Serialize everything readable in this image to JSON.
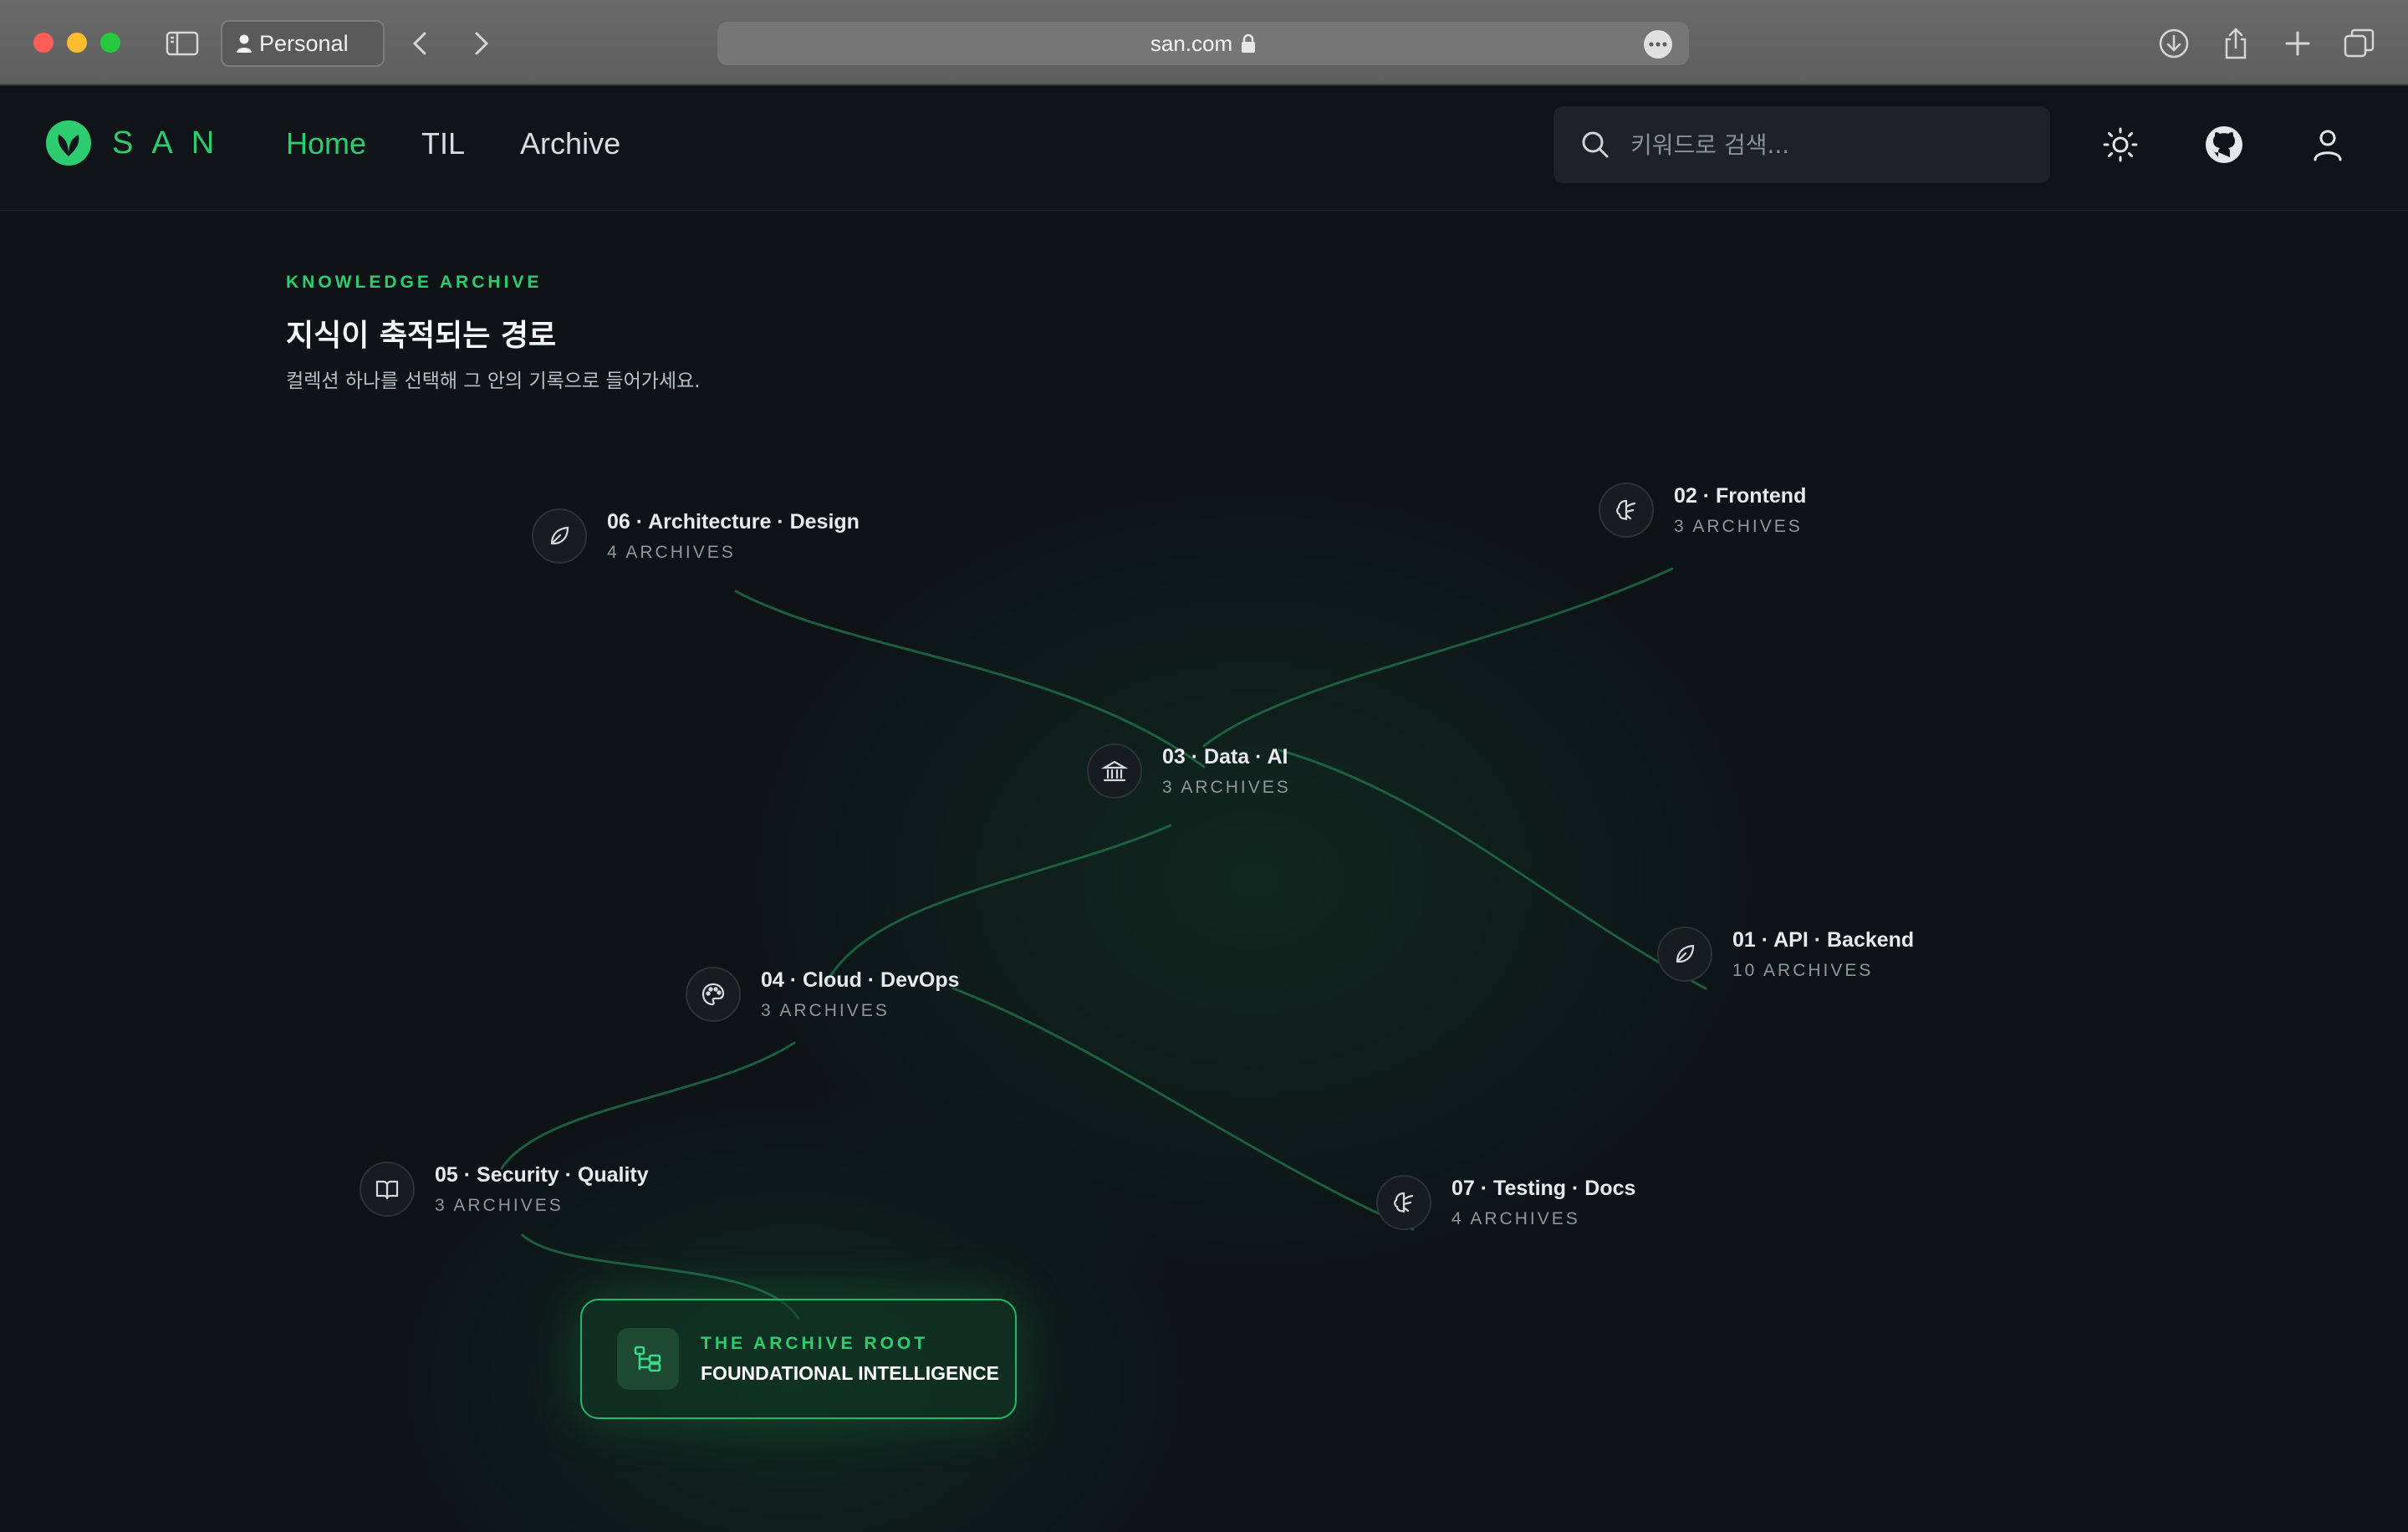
{
  "browser": {
    "profile_label": "Personal",
    "url": "san.com"
  },
  "header": {
    "logo_text": "SAN",
    "nav": [
      {
        "label": "Home",
        "active": true
      },
      {
        "label": "TIL",
        "active": false
      },
      {
        "label": "Archive",
        "active": false
      }
    ],
    "search_placeholder": "키워드로 검색..."
  },
  "main": {
    "eyebrow": "KNOWLEDGE ARCHIVE",
    "title": "지식이 축적되는 경로",
    "subtitle": "컬렉션 하나를 선택해 그 안의 기록으로 들어가세요."
  },
  "nodes": [
    {
      "title": "06 · Architecture · Design",
      "count": "4 ARCHIVES",
      "icon": "leaf-icon"
    },
    {
      "title": "02 · Frontend",
      "count": "3 ARCHIVES",
      "icon": "brain-icon"
    },
    {
      "title": "03 · Data · AI",
      "count": "3 ARCHIVES",
      "icon": "bank-icon"
    },
    {
      "title": "01 · API · Backend",
      "count": "10 ARCHIVES",
      "icon": "leaf-icon"
    },
    {
      "title": "04 · Cloud · DevOps",
      "count": "3 ARCHIVES",
      "icon": "palette-icon"
    },
    {
      "title": "05 · Security · Quality",
      "count": "3 ARCHIVES",
      "icon": "book-icon"
    },
    {
      "title": "07 · Testing · Docs",
      "count": "4 ARCHIVES",
      "icon": "brain-icon"
    }
  ],
  "root": {
    "eyebrow": "THE ARCHIVE ROOT",
    "title": "FOUNDATIONAL INTELLIGENCE",
    "icon": "tree-icon"
  },
  "colors": {
    "accent": "#2ecc71",
    "background": "#0e1316",
    "link_line": "#1f6a48"
  }
}
